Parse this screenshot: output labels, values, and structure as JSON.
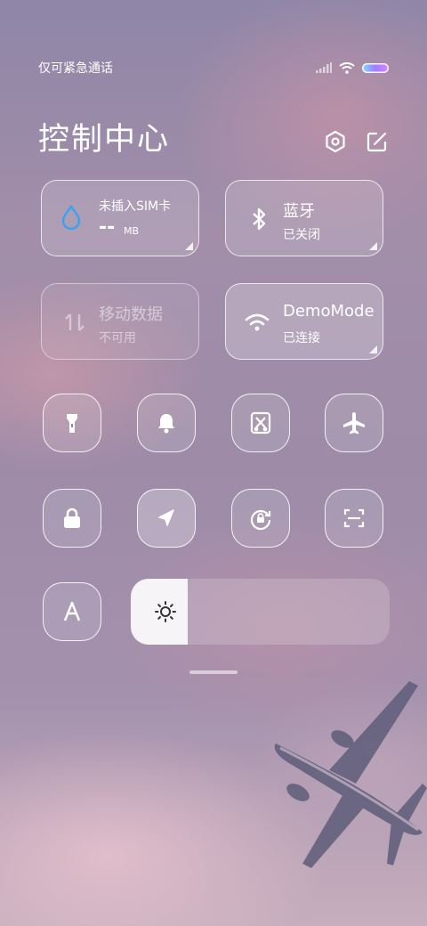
{
  "status_bar": {
    "carrier_text": "仅可紧急通话"
  },
  "header": {
    "title": "控制中心"
  },
  "tiles": {
    "data_usage": {
      "name": "未插入SIM卡",
      "value": "--",
      "unit": "MB"
    },
    "bluetooth": {
      "name": "蓝牙",
      "status": "已关闭"
    },
    "mobile_data": {
      "name": "移动数据",
      "status": "不可用"
    },
    "wifi": {
      "name": "DemoMode",
      "status": "已连接"
    }
  },
  "toggles": {
    "row1": [
      "flashlight-icon",
      "bell-icon",
      "screenshot-icon",
      "airplane-icon"
    ],
    "row2": [
      "lock-icon",
      "location-icon",
      "rotation-lock-icon",
      "scan-icon"
    ],
    "row3": [
      "auto-brightness-icon"
    ]
  },
  "brightness": {
    "level": 0.22
  },
  "colors": {
    "accent_blue": "#3aa0f0"
  }
}
